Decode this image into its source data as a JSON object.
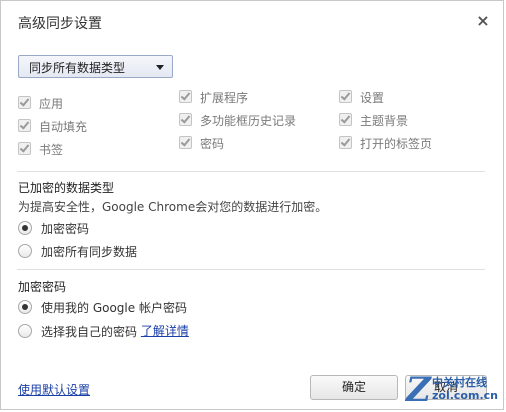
{
  "dialog": {
    "title": "高级同步设置",
    "close_icon": "×"
  },
  "sync_select": {
    "value": "同步所有数据类型"
  },
  "data_types": [
    {
      "label": "应用",
      "checked": true
    },
    {
      "label": "扩展程序",
      "checked": true
    },
    {
      "label": "设置",
      "checked": true
    },
    {
      "label": "自动填充",
      "checked": true
    },
    {
      "label": "多功能框历史记录",
      "checked": true
    },
    {
      "label": "主题背景",
      "checked": true
    },
    {
      "label": "书签",
      "checked": true
    },
    {
      "label": "密码",
      "checked": true
    },
    {
      "label": "打开的标签页",
      "checked": true
    }
  ],
  "encrypted_section": {
    "title": "已加密的数据类型",
    "description": "为提高安全性，Google Chrome会对您的数据进行加密。",
    "options": [
      {
        "label": "加密密码",
        "selected": true
      },
      {
        "label": "加密所有同步数据",
        "selected": false
      }
    ]
  },
  "passphrase_section": {
    "title": "加密密码",
    "options": [
      {
        "label": "使用我的 Google 帐户密码",
        "selected": true
      },
      {
        "label": "选择我自己的密码",
        "selected": false
      }
    ],
    "learn_more": "了解详情"
  },
  "footer": {
    "default_link": "使用默认设置",
    "ok_button": "确定",
    "cancel_button": "取消"
  },
  "watermark": {
    "letter": "Z",
    "cn": "中关村在线",
    "en": "zol.com.cn"
  }
}
